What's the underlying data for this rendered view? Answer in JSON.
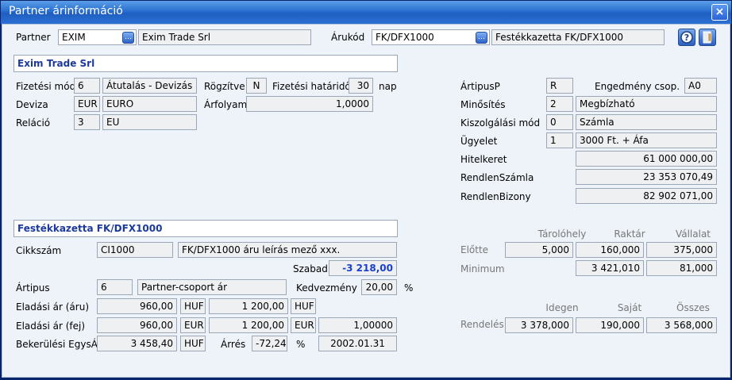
{
  "window": {
    "title": "Partner árinformáció",
    "close_glyph": "×"
  },
  "top": {
    "partner_label": "Partner",
    "partner_code": "EXIM",
    "partner_name": "Exim Trade Srl",
    "arukod_label": "Árukód",
    "arukod_code": "FK/DFX1000",
    "arukod_name": "Festékkazetta FK/DFX1000",
    "picker_glyph": "…"
  },
  "partner": {
    "header": "Exim Trade Srl",
    "fizetesi_mod_label": "Fizetési mód",
    "fizetesi_mod_code": "6",
    "fizetesi_mod_name": "Átutalás - Devizás",
    "rogzitve_label": "Rögzítve",
    "rogzitve_value": "N",
    "hatarido_label": "Fizetési határidő",
    "hatarido_value": "30",
    "hatarido_unit": "nap",
    "deviza_label": "Deviza",
    "deviza_code": "EUR",
    "deviza_name": "EURO",
    "arfolyam_label": "Árfolyam",
    "arfolyam_value": "1,0000",
    "relacio_label": "Reláció",
    "relacio_code": "3",
    "relacio_name": "EU"
  },
  "right": {
    "artipusp_label": "ÁrtipusP",
    "artipusp_value": "R",
    "engedmeny_label": "Engedmény csop.",
    "engedmeny_value": "A0",
    "minosites_label": "Minősítés",
    "minosites_code": "2",
    "minosites_name": "Megbízható",
    "kiszolgalasi_label": "Kiszolgálási mód",
    "kiszolgalasi_code": "0",
    "kiszolgalasi_name": "Számla",
    "ugyelet_label": "Ügyelet",
    "ugyelet_code": "1",
    "ugyelet_name": "3000 Ft. + Áfa",
    "hitelkeret_label": "Hitelkeret",
    "hitelkeret_value": "61 000 000,00",
    "rendlenszamla_label": "RendlenSzámla",
    "rendlenszamla_value": "23 353 070,49",
    "rendlenbizony_label": "RendlenBizony",
    "rendlenbizony_value": "82 902 071,00"
  },
  "item": {
    "header": "Festékkazetta FK/DFX1000",
    "cikkszam_label": "Cikkszám",
    "cikkszam_code": "CI1000",
    "cikkszam_desc": "FK/DFX1000 áru leírás mező xxx.",
    "szabad_label": "Szabad",
    "szabad_value": "-3 218,00",
    "artipus_label": "Ártipus",
    "artipus_code": "6",
    "artipus_name": "Partner-csoport ár",
    "kedvezmeny_label": "Kedvezmény",
    "kedvezmeny_value": "20,00",
    "kedvezmeny_unit": "%",
    "elad_aru_label": "Eladási ár (áru)",
    "elad_aru_1": "960,00",
    "elad_aru_cur1": "HUF",
    "elad_aru_2": "1 200,00",
    "elad_aru_cur2": "HUF",
    "elad_fej_label": "Eladási ár (fej)",
    "elad_fej_1": "960,00",
    "elad_fej_cur1": "EUR",
    "elad_fej_2": "1 200,00",
    "elad_fej_cur2": "EUR",
    "elad_fej_rate": "1,00000",
    "bekerulesi_label": "Bekerülési EgysÁr",
    "bekerulesi_value": "3 458,40",
    "bekerulesi_cur": "HUF",
    "arres_label": "Árrés",
    "arres_value": "-72,24",
    "arres_unit": "%",
    "date": "2002.01.31"
  },
  "stock": {
    "col_tarolohely": "Tárolóhely",
    "col_raktar": "Raktár",
    "col_vallalat": "Vállalat",
    "elotte_label": "Előtte",
    "elotte_1": "5,000",
    "elotte_2": "160,000",
    "elotte_3": "375,000",
    "minimum_label": "Minimum",
    "minimum_2": "3 421,010",
    "minimum_3": "81,000",
    "col_idegen": "Idegen",
    "col_sajat": "Saját",
    "col_osszes": "Összes",
    "rendeles_label": "Rendelés",
    "rendeles_1": "3 378,000",
    "rendeles_2": "190,000",
    "rendeles_3": "3 568,000"
  },
  "toolbar": {
    "help_glyph": "?",
    "exit_glyph": "⇥"
  }
}
